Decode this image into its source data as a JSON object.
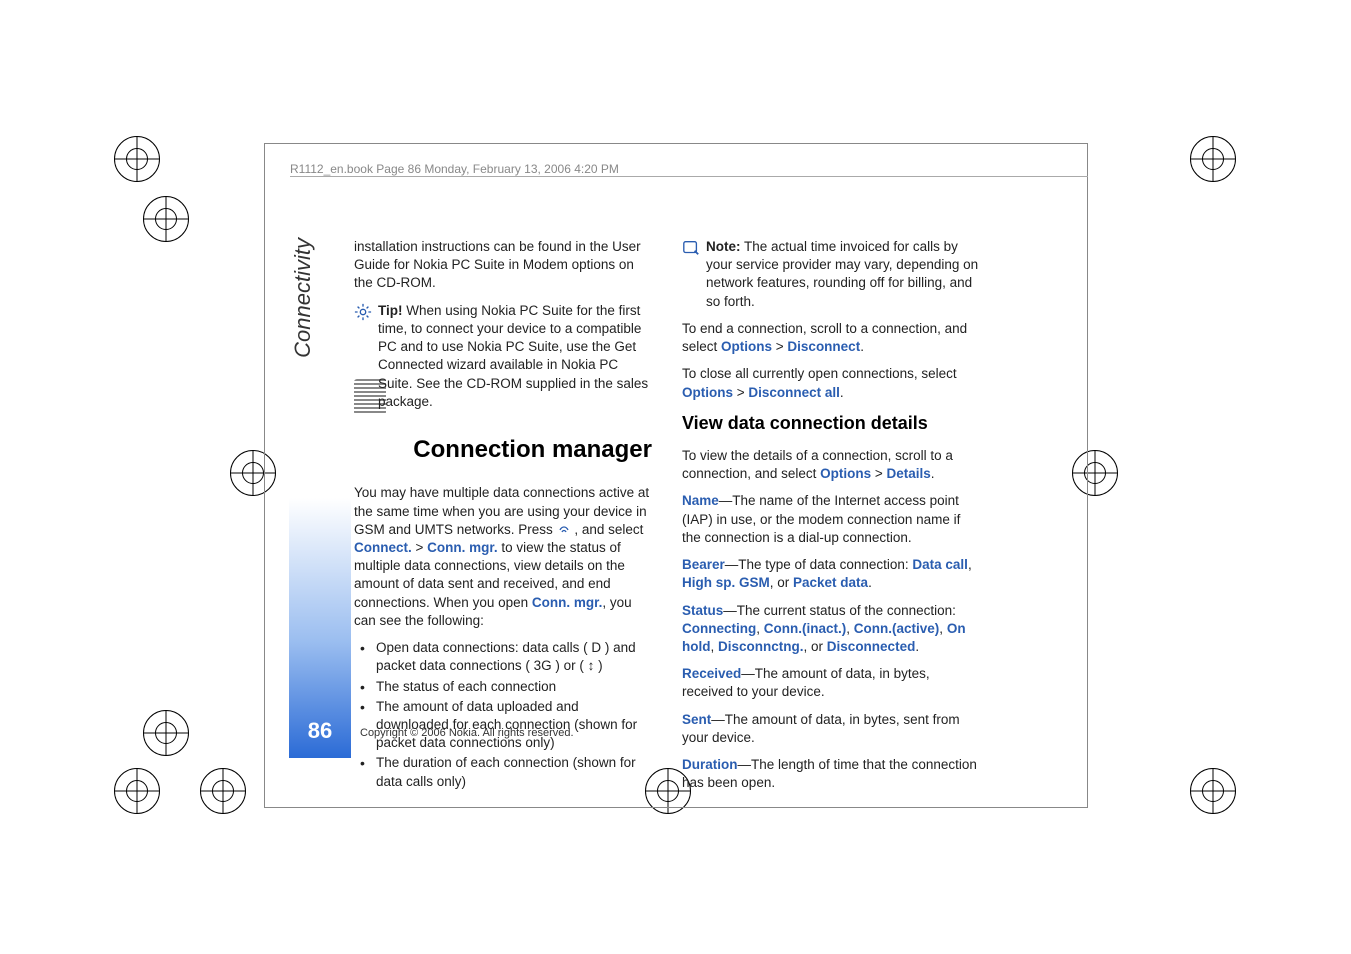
{
  "header": "R1112_en.book  Page 86  Monday, February 13, 2006  4:20 PM",
  "side_tab": "Connectivity",
  "page_number": "86",
  "copyright": "Copyright © 2006 Nokia. All rights reserved.",
  "col1": {
    "intro": "installation instructions can be found in the User Guide for Nokia PC Suite in Modem options on the CD-ROM.",
    "tip_label": "Tip!",
    "tip_body": " When using Nokia PC Suite for the first time, to connect your device to a compatible PC and to use Nokia PC Suite, use the Get Connected wizard available in Nokia PC Suite. See the CD-ROM supplied in the sales package.",
    "section_title": "Connection manager",
    "p1a": "You may have multiple data connections active at the same time when you are using your device in GSM and UMTS networks. Press ",
    "p1b": " , and select ",
    "link_connect": "Connect.",
    "link_connmgr": "Conn. mgr.",
    "p1c": " to view the status of multiple data connections, view details on the amount of data sent and received, and end connections. When you open ",
    "p1d": ", you can see the following:",
    "bullets": [
      "Open data connections: data calls ( D ) and packet data connections ( 3G ) or ( ↕ )",
      "The status of each connection",
      "The amount of data uploaded and downloaded for each connection (shown for packet data connections only)",
      "The duration of each connection (shown for data calls only)"
    ]
  },
  "col2": {
    "note_label": "Note:",
    "note_body": " The actual time invoiced for calls by your service provider may vary, depending on network features, rounding off for billing, and so forth.",
    "end_a": "To end a connection, scroll to a connection, and select ",
    "options": "Options",
    "disconnect": "Disconnect",
    "close_a": "To close all currently open connections, select ",
    "disconnect_all": "Disconnect all",
    "sub_title": "View data connection details",
    "view_a": "To view the details of a connection, scroll to a connection, and select ",
    "details": "Details",
    "defs": {
      "name_k": "Name",
      "name_v": "—The name of the Internet access point (IAP) in use, or the modem connection name if the connection is a dial-up connection.",
      "bearer_k": "Bearer",
      "bearer_v1": "—The type of data connection: ",
      "bearer_o1": "Data call",
      "bearer_o2": "High sp. GSM",
      "bearer_o3": "Packet data",
      "status_k": "Status",
      "status_v1": "—The current status of the connection: ",
      "status_o1": "Connecting",
      "status_o2": "Conn.(inact.)",
      "status_o3": "Conn.(active)",
      "status_o4": "On hold",
      "status_o5": "Disconnctng.",
      "status_o6": "Disconnected",
      "recv_k": "Received",
      "recv_v": "—The amount of data, in bytes, received to your device.",
      "sent_k": "Sent",
      "sent_v": "—The amount of data, in bytes, sent from your device.",
      "dur_k": "Duration",
      "dur_v": "—The length of time that the connection has been open."
    }
  }
}
